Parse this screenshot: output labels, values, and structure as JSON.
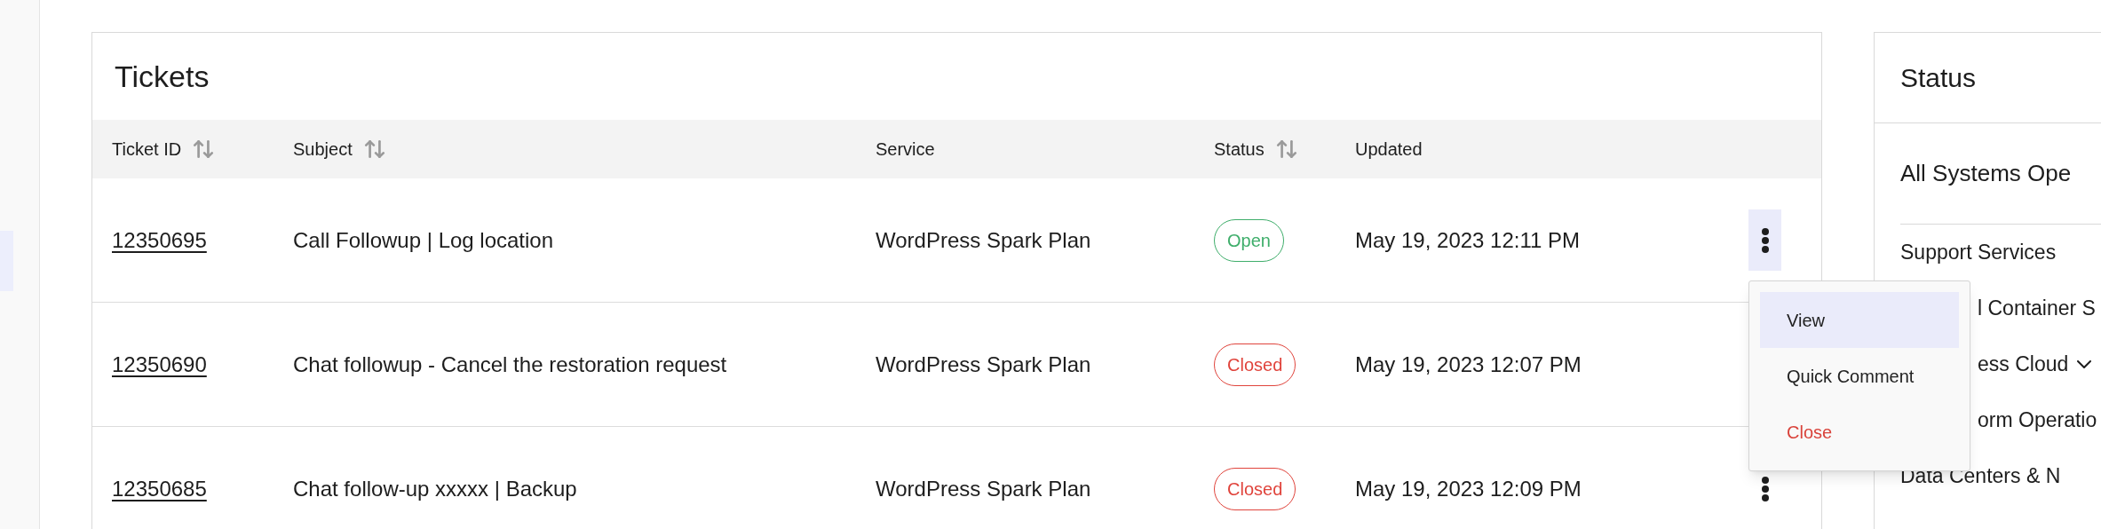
{
  "sidebar": {
    "items": [
      {
        "selected": true
      }
    ]
  },
  "tickets": {
    "title": "Tickets",
    "columns": [
      {
        "label": "Ticket ID",
        "sortable": true
      },
      {
        "label": "Subject",
        "sortable": true
      },
      {
        "label": "Service",
        "sortable": false
      },
      {
        "label": "Status",
        "sortable": true
      },
      {
        "label": "Updated",
        "sortable": false
      }
    ],
    "rows": [
      {
        "id": "12350695",
        "subject": "Call Followup | Log location",
        "service": "WordPress Spark Plan",
        "status": {
          "label": "Open",
          "kind": "open"
        },
        "updated": "May 19, 2023 12:11 PM",
        "menu_open": true
      },
      {
        "id": "12350690",
        "subject": "Chat followup - Cancel the restoration request",
        "service": "WordPress Spark Plan",
        "status": {
          "label": "Closed",
          "kind": "closed"
        },
        "updated": "May 19, 2023 12:07 PM",
        "menu_open": false
      },
      {
        "id": "12350685",
        "subject": "Chat follow-up xxxxx | Backup",
        "service": "WordPress Spark Plan",
        "status": {
          "label": "Closed",
          "kind": "closed"
        },
        "updated": "May 19, 2023 12:09 PM",
        "menu_open": false
      }
    ],
    "row_menu": [
      {
        "label": "View",
        "selected": true,
        "kind": "normal"
      },
      {
        "label": "Quick Comment",
        "selected": false,
        "kind": "normal"
      },
      {
        "label": "Close",
        "selected": false,
        "kind": "danger"
      }
    ]
  },
  "status": {
    "title": "Status",
    "summary": "All Systems Ope",
    "items": [
      {
        "label": "Support Services",
        "expandable": false
      },
      {
        "label": "l Container S",
        "expandable": false
      },
      {
        "label": "ess Cloud",
        "expandable": true
      },
      {
        "label": "orm Operatio",
        "expandable": false
      },
      {
        "label": "Data Centers & N",
        "expandable": false
      }
    ]
  }
}
